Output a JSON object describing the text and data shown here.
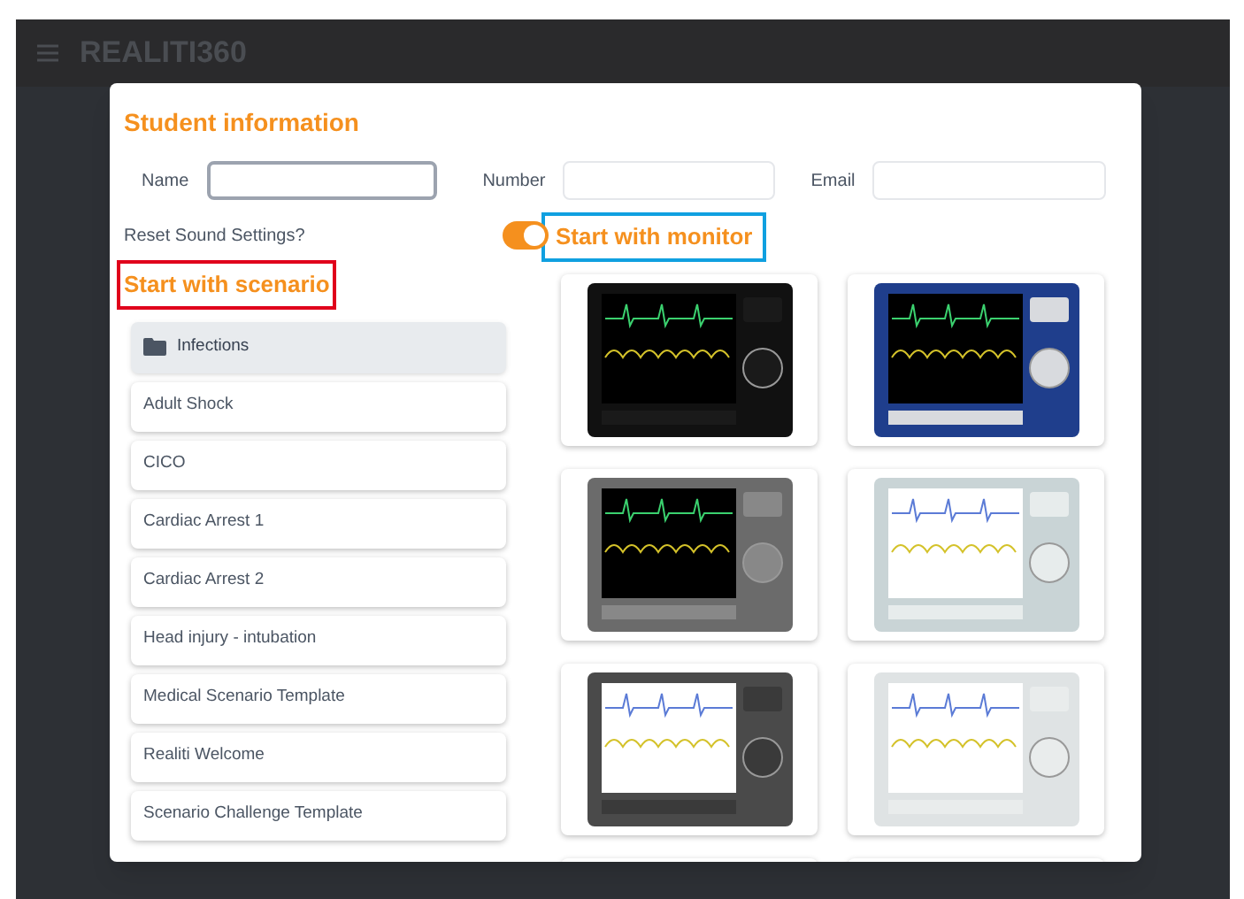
{
  "app_bar": {
    "logo": "REALITI360"
  },
  "dialog": {
    "title": "Student information",
    "fields": [
      {
        "label": "Name",
        "focused": true
      },
      {
        "label": "Number",
        "focused": false
      },
      {
        "label": "Email",
        "focused": false
      }
    ],
    "reset_sound": {
      "label": "Reset Sound Settings?",
      "on": true
    },
    "scenario_heading": "Start with scenario",
    "monitor_heading": "Start with monitor",
    "scenarios": [
      {
        "kind": "folder",
        "label": "Infections"
      },
      {
        "kind": "scenario",
        "label": "Adult Shock"
      },
      {
        "kind": "scenario",
        "label": "CICO"
      },
      {
        "kind": "scenario",
        "label": "Cardiac Arrest 1"
      },
      {
        "kind": "scenario",
        "label": "Cardiac Arrest 2"
      },
      {
        "kind": "scenario",
        "label": "Head injury - intubation"
      },
      {
        "kind": "scenario",
        "label": "Medical Scenario Template"
      },
      {
        "kind": "scenario",
        "label": "Realiti Welcome"
      },
      {
        "kind": "scenario",
        "label": "Scenario Challenge Template"
      }
    ],
    "monitors": [
      {
        "kind": "black"
      },
      {
        "kind": "blue"
      },
      {
        "kind": "grey"
      },
      {
        "kind": "light"
      },
      {
        "kind": "dark"
      },
      {
        "kind": "white"
      },
      {
        "kind": "partial"
      },
      {
        "kind": "partial"
      }
    ]
  }
}
